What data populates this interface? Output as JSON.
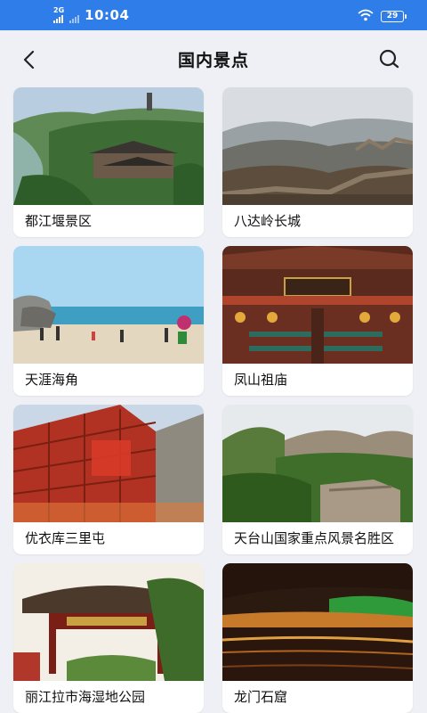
{
  "status_bar": {
    "network": "2G",
    "time": "10:04",
    "battery": "29"
  },
  "header": {
    "title": "国内景点"
  },
  "icons": {
    "back": "back-arrow-icon",
    "search": "search-icon"
  },
  "colors": {
    "status_bar": "#2f7de9",
    "background": "#eef0f5",
    "card": "#ffffff"
  },
  "attractions": [
    {
      "name": "都江堰景区"
    },
    {
      "name": "八达岭长城"
    },
    {
      "name": "天涯海角"
    },
    {
      "name": "凤山祖庙"
    },
    {
      "name": "优衣库三里屯"
    },
    {
      "name": "天台山国家重点风景名胜区"
    },
    {
      "name": "丽江拉市海湿地公园"
    },
    {
      "name": "龙门石窟"
    }
  ]
}
